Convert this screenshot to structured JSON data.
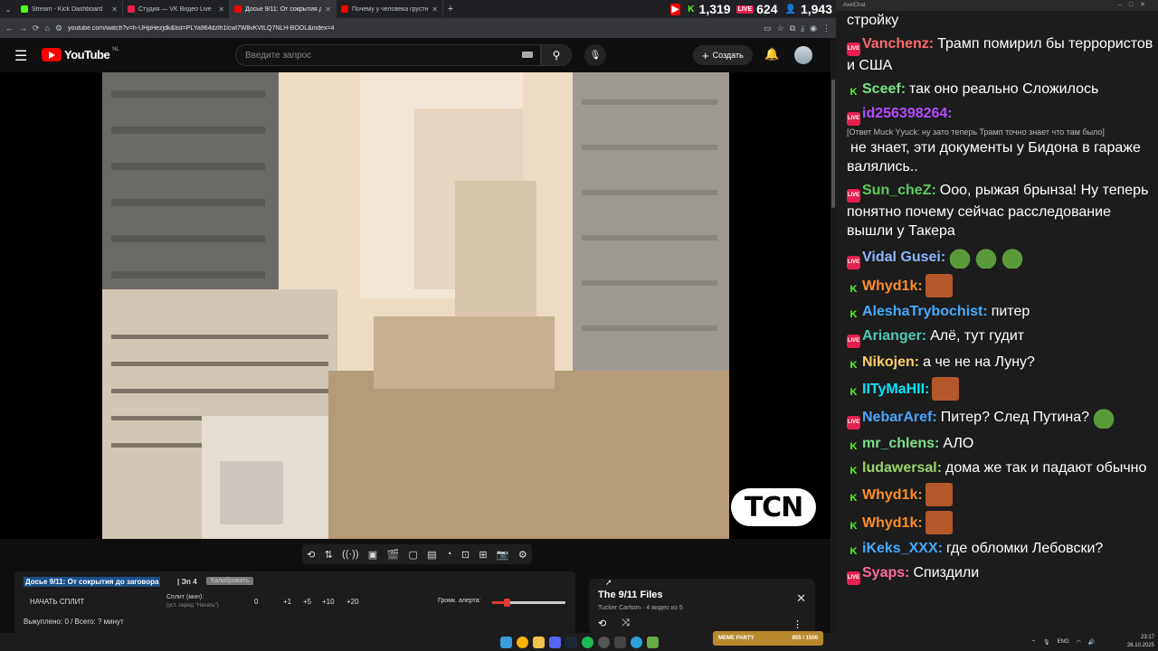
{
  "browser": {
    "tabs": [
      {
        "title": "Stream - Kick Dashboard",
        "color": "#53fc18"
      },
      {
        "title": "Студия — VK Видео Live",
        "color": "#e6204e"
      },
      {
        "title": "Досье 9/11: От сокрытия до...",
        "color": "#ff0000",
        "active": true
      },
      {
        "title": "Почему у человека грустно и...",
        "color": "#ff0000"
      }
    ],
    "stats": {
      "kick": "1,319",
      "vk": "624",
      "total": "1,943"
    },
    "url": "youtube.com/watch?v=h-UHpHezjdk&list=PLYa964dzlh1lcwl7W8vKVtLQ7NLH-BOOL&index=4"
  },
  "youtube": {
    "logo": "YouTube",
    "country": "NL",
    "search_placeholder": "Введите запрос",
    "create_label": "Создать"
  },
  "video": {
    "watermark": "TCN"
  },
  "split": {
    "title": "Досье 9/11: От сокрытия до заговора",
    "episode": "| Эп 4",
    "badge": "Калибровать",
    "start_label": "НАЧАТЬ СПЛИТ",
    "min_label": "Сплит (мин):",
    "hint": "(уст. перед \"Начать\")",
    "values": [
      "0",
      "+1",
      "+5",
      "+10",
      "+20"
    ],
    "alert_label": "Громк. алерта:",
    "alert_level": 0.2,
    "stats": "Выкуплено: 0 / Всего: ? минут"
  },
  "playlist": {
    "title": "The 9/11 Files",
    "subtitle": "Tucker Carlson · 4 видео из 5"
  },
  "chat": {
    "window_title": "AxelChat",
    "messages": [
      {
        "platform": "none",
        "name": "",
        "color": "#fff",
        "text": "стройку"
      },
      {
        "platform": "vk",
        "name": "Vanchenz:",
        "color": "#ff6b6b",
        "text": "Трамп помирил бы террористов и США"
      },
      {
        "platform": "kick",
        "name": "Sceef:",
        "color": "#7be08a",
        "text": "так оно реально Сложилось"
      },
      {
        "platform": "vk",
        "name": "id256398264:",
        "color": "#b44cff",
        "reply": "[Ответ Muck Yyuck: ну зато теперь Трамп точно знает что там было]",
        "text": "не знает, эти документы у Бидона в гараже валялись.."
      },
      {
        "platform": "vk",
        "name": "Sun_cheZ:",
        "color": "#5ecb5e",
        "text": "Ооо, рыжая брынза! Ну теперь понятно почему сейчас расследование вышли у Такера"
      },
      {
        "platform": "vk",
        "name": "Vidal Gusei:",
        "color": "#8fb4ff",
        "text": "",
        "emotes": [
          "frog",
          "frog",
          "frog"
        ]
      },
      {
        "platform": "kick",
        "name": "Whyd1k:",
        "color": "#ff8c2a",
        "text": "",
        "emotes": [
          "face"
        ]
      },
      {
        "platform": "kick",
        "name": "AleshaTrybochist:",
        "color": "#44aaff",
        "text": "питер"
      },
      {
        "platform": "vk",
        "name": "Arianger:",
        "color": "#4ec9b0",
        "text": "Алё, тут гудит"
      },
      {
        "platform": "kick",
        "name": "Nikojen:",
        "color": "#ffcf6b",
        "text": "а че не на Луну?"
      },
      {
        "platform": "kick",
        "name": "IITyMaHII:",
        "color": "#00e5ff",
        "text": "",
        "emotes": [
          "face"
        ]
      },
      {
        "platform": "vk",
        "name": "NebarAref:",
        "color": "#4aa3ff",
        "text": "Питер? След Путина?",
        "emotes": [
          "frog"
        ]
      },
      {
        "platform": "kick",
        "name": "mr_chlens:",
        "color": "#7be08a",
        "text": "АЛО"
      },
      {
        "platform": "kick",
        "name": "ludawersal:",
        "color": "#9bd36b",
        "text": "дома же так и падают обычно"
      },
      {
        "platform": "kick",
        "name": "Whyd1k:",
        "color": "#ff8c2a",
        "text": "",
        "emotes": [
          "face"
        ]
      },
      {
        "platform": "kick",
        "name": "Whyd1k:",
        "color": "#ff8c2a",
        "text": "",
        "emotes": [
          "face"
        ]
      },
      {
        "platform": "kick",
        "name": "iKeks_XXX:",
        "color": "#44aaff",
        "text": "где обломки Лебовски?"
      },
      {
        "platform": "vk",
        "name": "Syaps:",
        "color": "#ff6b9a",
        "text": "Спиздили"
      }
    ]
  },
  "taskbar": {
    "meme_label": "MEME PARTY",
    "meme_count": "855 / 1500",
    "lang": "ENG",
    "time": "23:17",
    "date": "26.10.2025"
  }
}
